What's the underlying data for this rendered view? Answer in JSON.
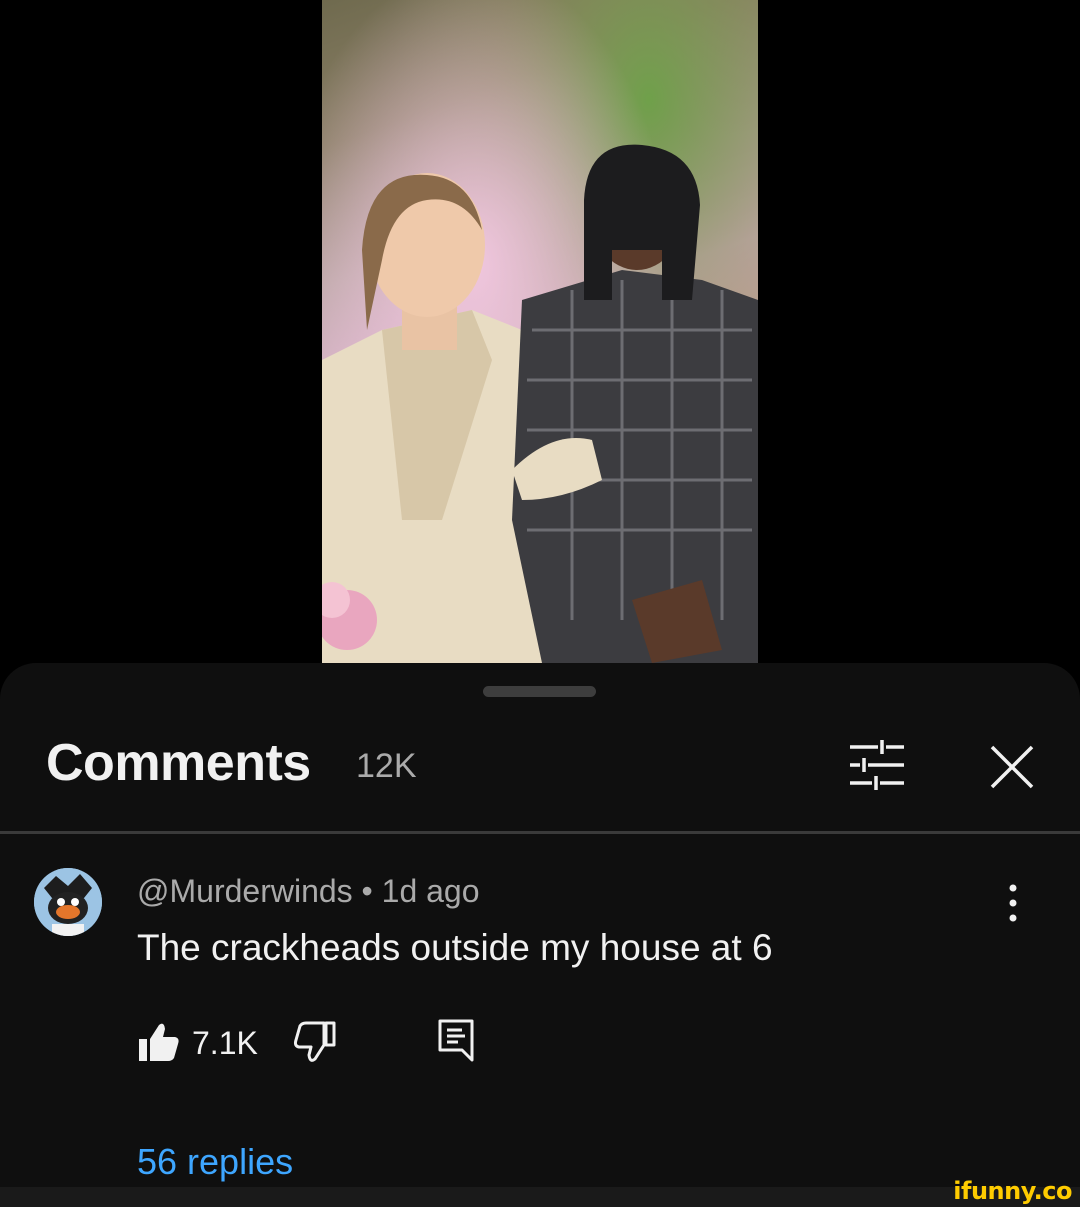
{
  "comments_sheet": {
    "title": "Comments",
    "count": "12K",
    "filter_icon": "filter-sliders-icon",
    "close_icon": "close-icon"
  },
  "comment": {
    "meta": "@Murderwinds • 1d ago",
    "text": "The crackheads outside my house at 6",
    "like_count": "7.1K",
    "replies_label": "56 replies"
  },
  "watermark": "ifunny.co",
  "colors": {
    "sheet_bg": "#0f0f0f",
    "link_blue": "#3ea6ff",
    "secondary_text": "#aaaaaa",
    "primary_text": "#f1f1f1",
    "watermark_yellow": "#ffcc00"
  }
}
